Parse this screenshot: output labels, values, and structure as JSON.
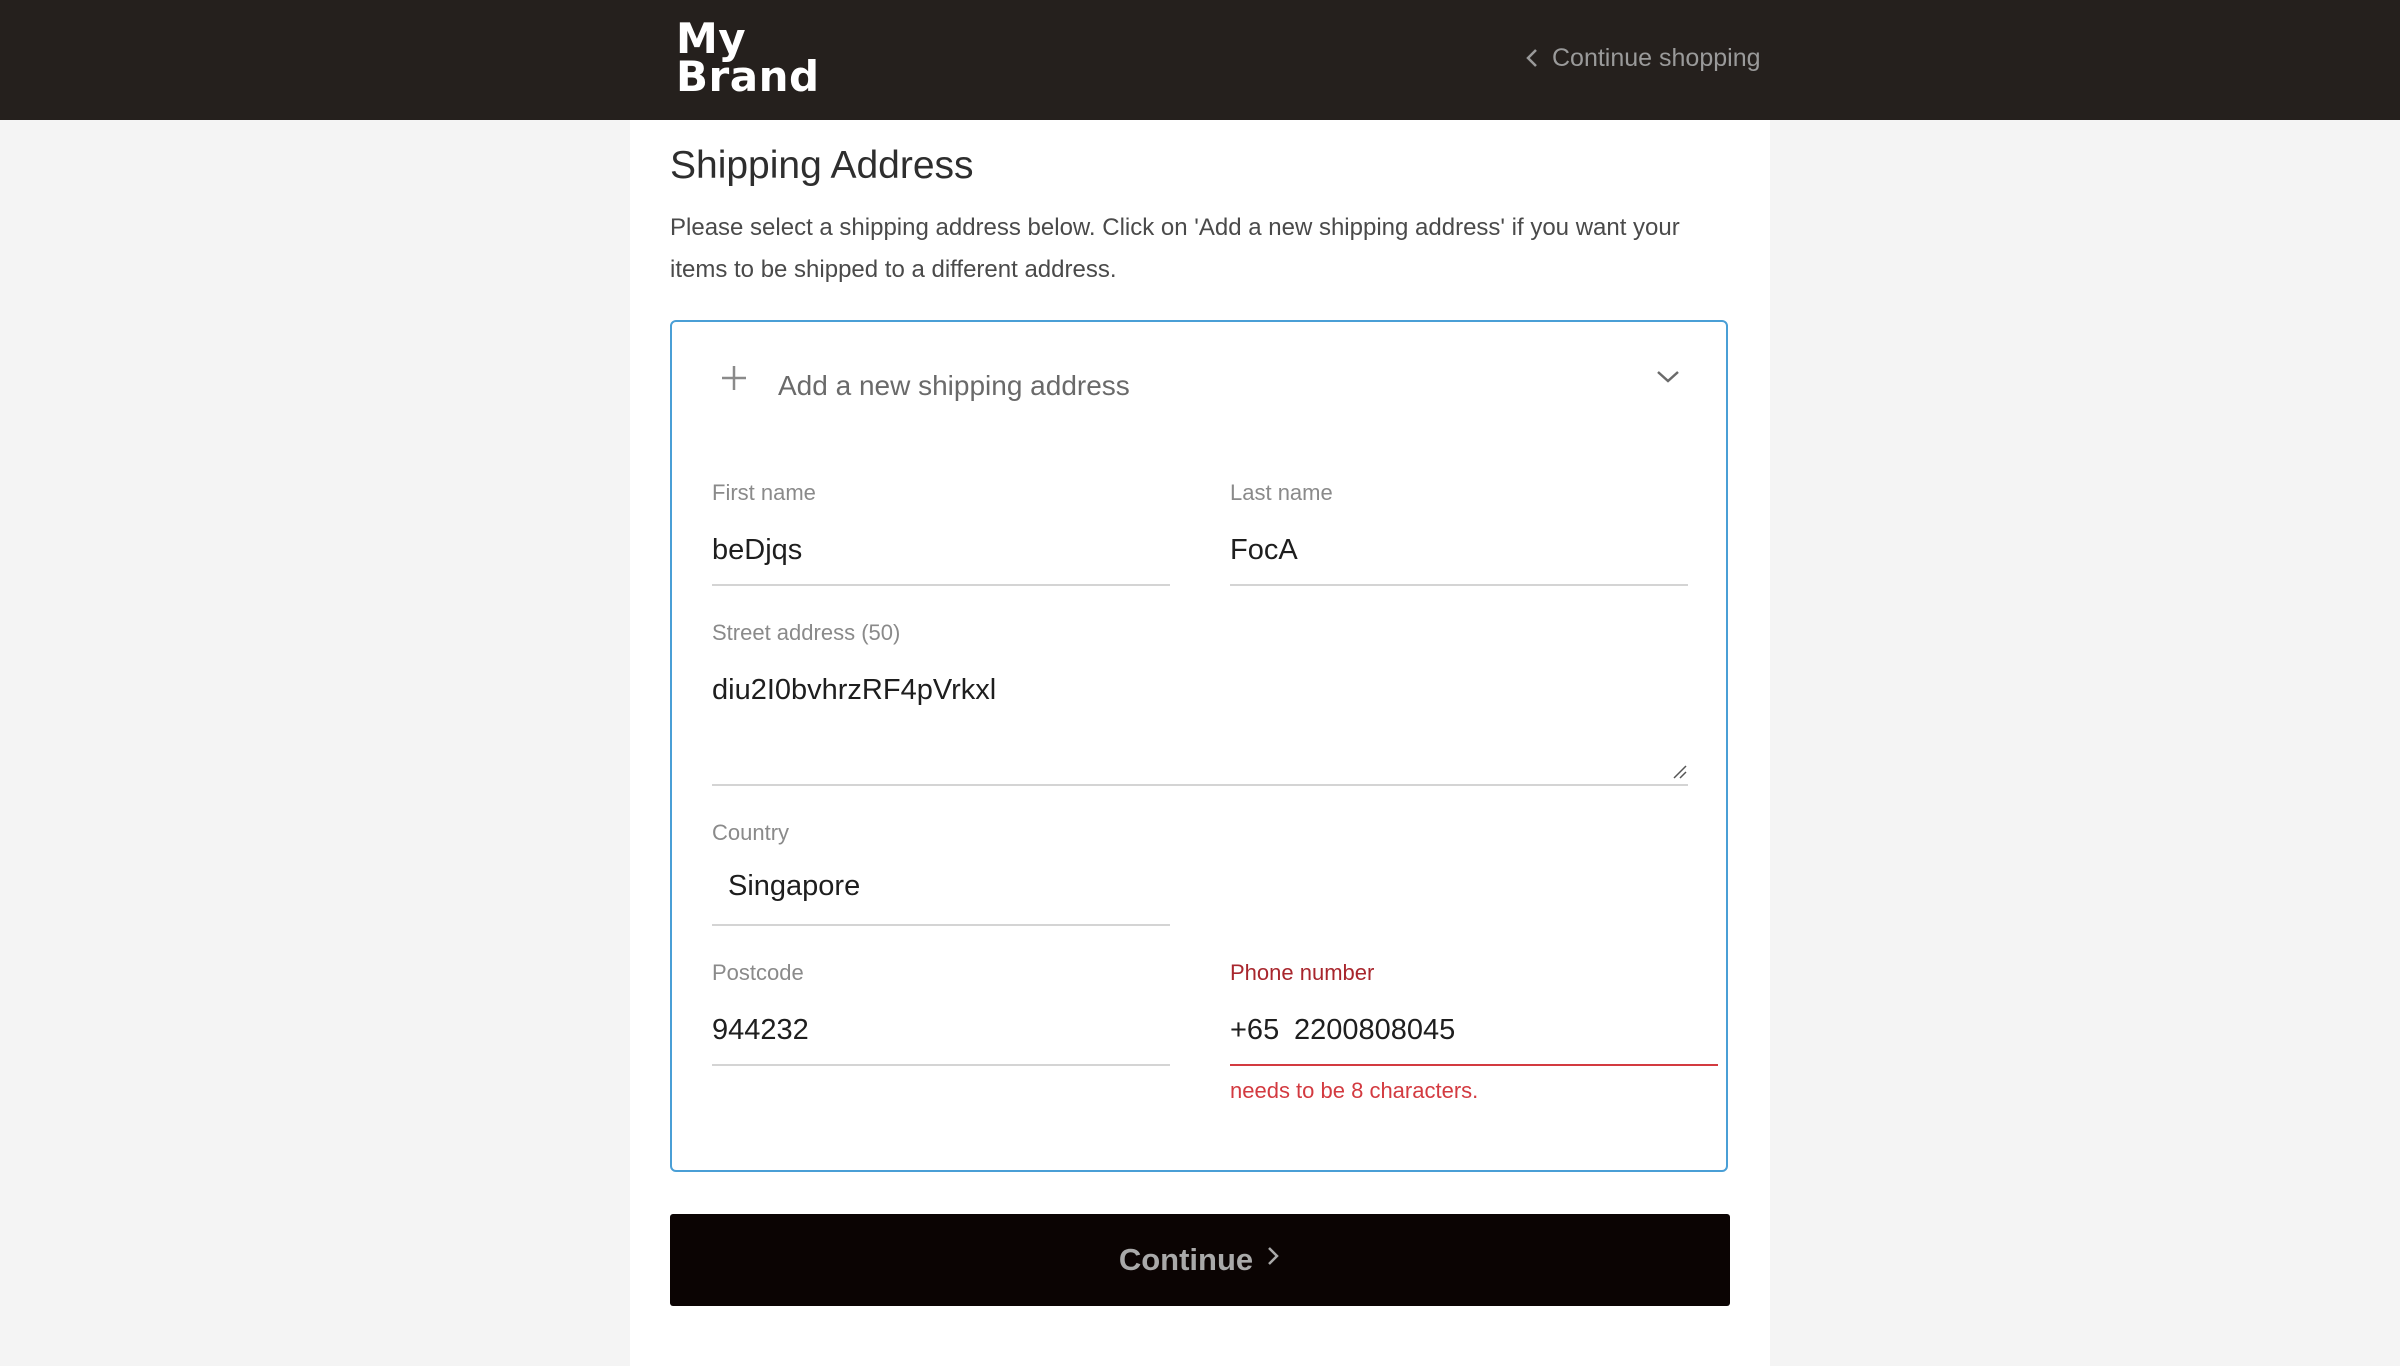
{
  "header": {
    "logo_line1": "My",
    "logo_line2": "Brand",
    "continue_shopping_label": "Continue shopping"
  },
  "page": {
    "title": "Shipping Address",
    "description": "Please select a shipping address below. Click on 'Add a new shipping address' if you want your items to be shipped to a different address."
  },
  "address_form": {
    "accordion_title": "Add a new shipping address",
    "first_name": {
      "label": "First name",
      "value": "beDjqs"
    },
    "last_name": {
      "label": "Last name",
      "value": "FocA"
    },
    "street_address": {
      "label": "Street address (50)",
      "value": "diu2I0bvhrzRF4pVrkxl"
    },
    "country": {
      "label": "Country",
      "value": "Singapore"
    },
    "postcode": {
      "label": "Postcode",
      "value": "944232"
    },
    "phone": {
      "label": "Phone number",
      "prefix": "+65",
      "value": "2200808045",
      "error": "needs to be 8 characters."
    }
  },
  "actions": {
    "continue_label": "Continue"
  },
  "colors": {
    "header_bg": "#25201d",
    "accent_border": "#4a9fd6",
    "error": "#d33a40",
    "button_bg": "#0b0403"
  },
  "icons": {
    "back": "chevron-left-icon",
    "add": "plus-icon",
    "expand": "chevron-down-icon",
    "next": "chevron-right-icon"
  }
}
